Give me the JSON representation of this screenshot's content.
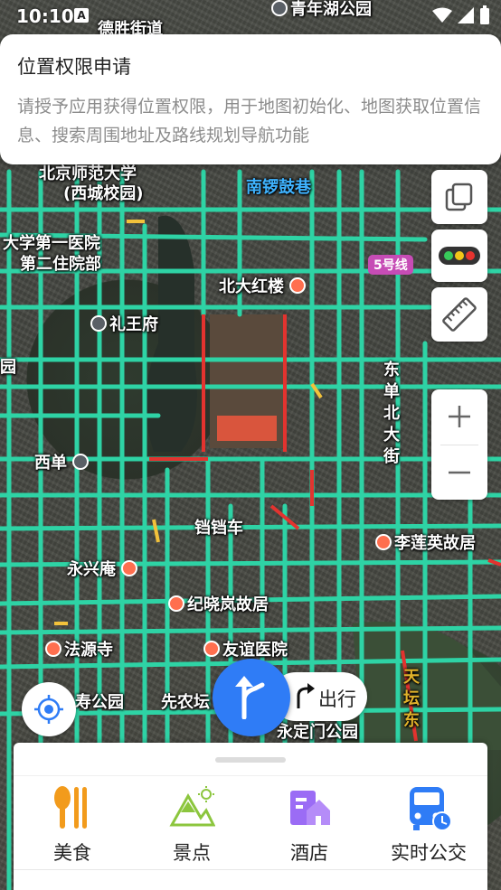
{
  "status_bar": {
    "time": "10:10",
    "a_badge": "A"
  },
  "permission": {
    "title": "位置权限申请",
    "description": "请授予应用获得位置权限，用于地图初始化、地图获取位置信息、搜索周围地址及路线规划导航功能"
  },
  "map": {
    "labels": {
      "top_street": "德胜街道",
      "top_park": "青年湖公园",
      "jingshan_top": "北京师范大学",
      "xicheng_campus": "(西城校园)",
      "nanluoguxiang": "南锣鼓巷",
      "hospital1": "大学第一医院",
      "hospital2": "第二住院部",
      "line5": "5号线",
      "beida_honglou": "北大红楼",
      "liwangfu": "礼王府",
      "dongdan": "东单北大街",
      "xidan": "西单",
      "xuanwumen": "铛铛车",
      "lilianying": "李莲英故居",
      "yongxingan": "永兴庵",
      "jixiaolan": "纪晓岚故居",
      "fayuansi": "法源寺",
      "youyi": "友谊医院",
      "taoranting": "寿公园",
      "xiannongtan": "先农坛",
      "yongdingmen": "永定门公园",
      "tiantan": "天坛东",
      "taoranting_full": "陶然亭公园",
      "left_edge": "园"
    }
  },
  "controls": {
    "layers_icon": "layers-icon",
    "traffic_icon": "traffic-light-icon",
    "ruler_icon": "ruler-icon",
    "zoom_in": "+",
    "zoom_out": "−",
    "route_label": "出行"
  },
  "categories": [
    {
      "label": "美食",
      "icon": "food-icon",
      "color": "#f29b1c"
    },
    {
      "label": "景点",
      "icon": "scenic-icon",
      "color": "#8cc63e"
    },
    {
      "label": "酒店",
      "icon": "hotel-icon",
      "color": "#9b6cf5"
    },
    {
      "label": "实时公交",
      "icon": "bus-icon",
      "color": "#2f7cf6"
    }
  ],
  "colors": {
    "accent": "#2f7cf6",
    "road": "#2ed3a5",
    "jam": "#e3332f"
  }
}
